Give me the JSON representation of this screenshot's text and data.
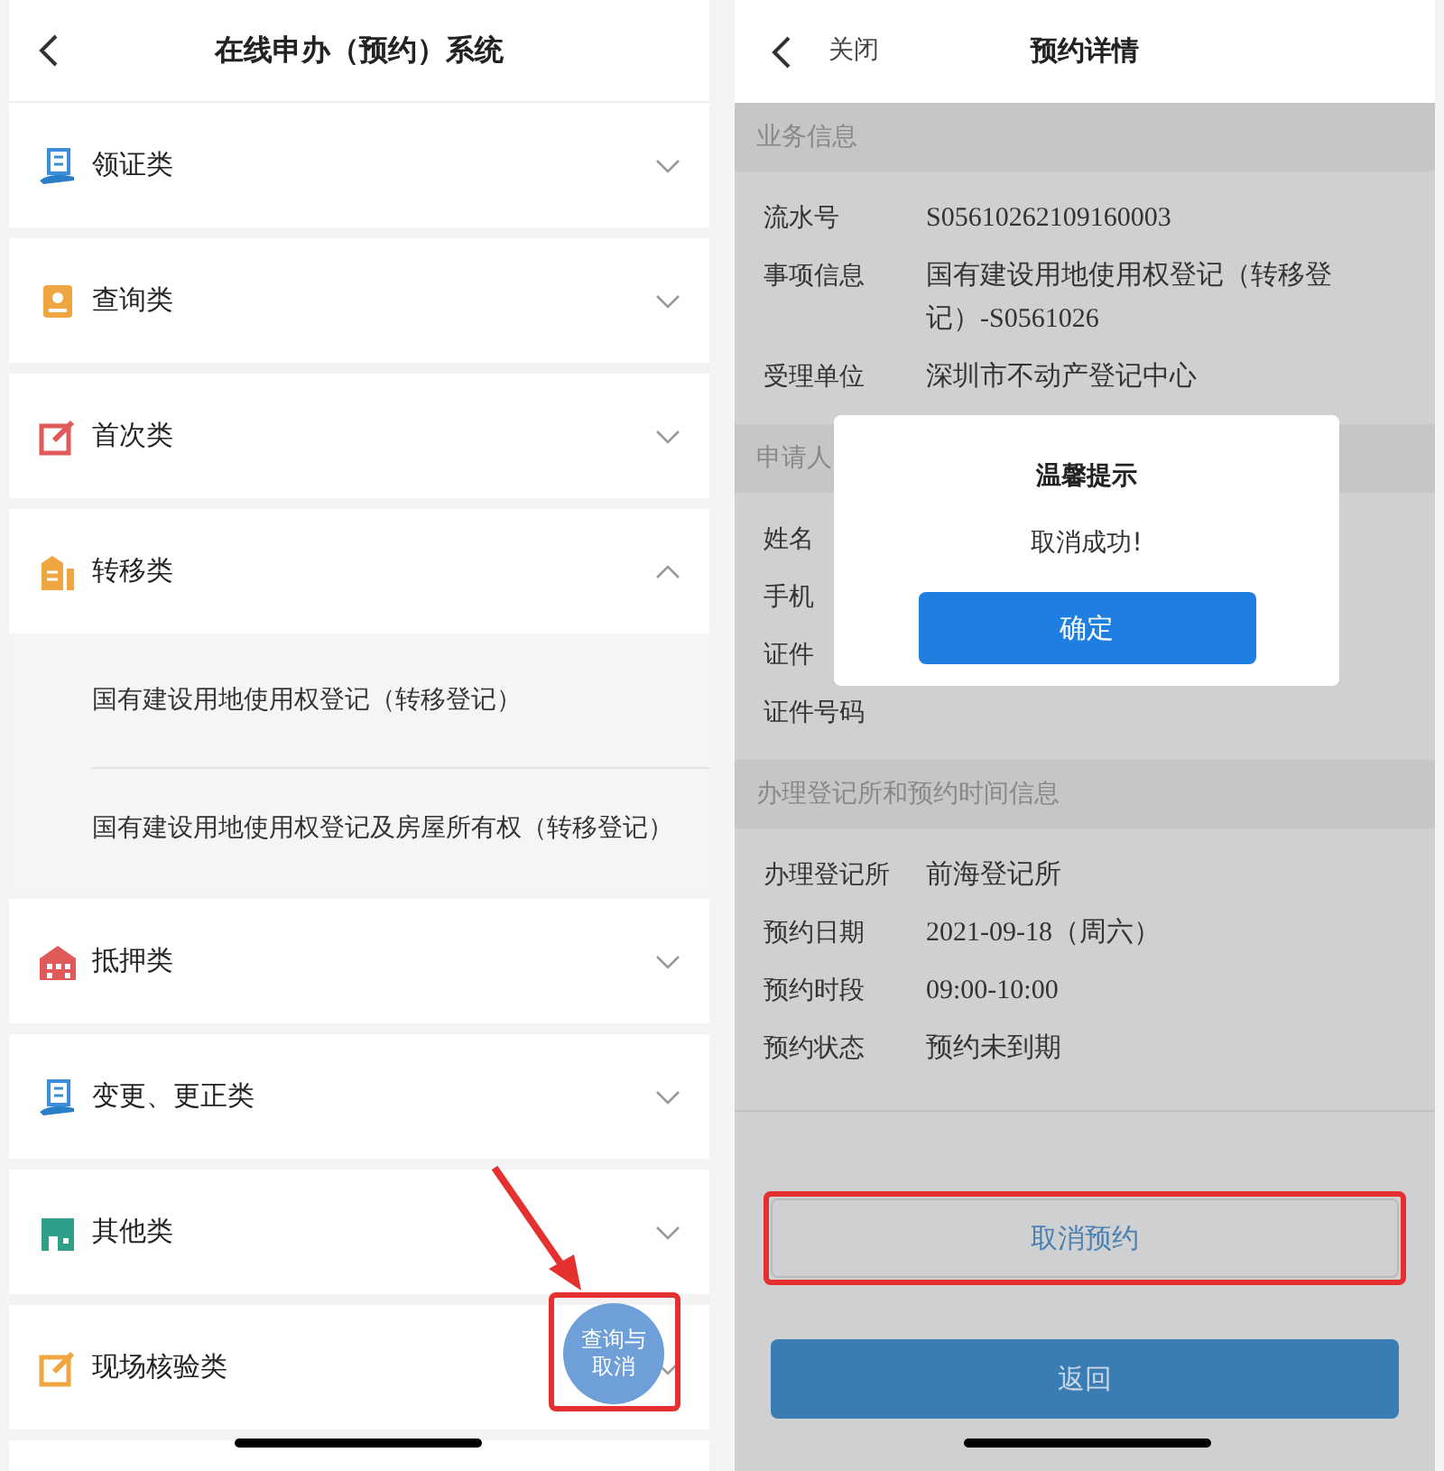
{
  "left_screen": {
    "header": {
      "title": "在线申办（预约）系统"
    },
    "categories": [
      {
        "label": "领证类",
        "expanded": false
      },
      {
        "label": "查询类",
        "expanded": false
      },
      {
        "label": "首次类",
        "expanded": false
      },
      {
        "label": "转移类",
        "expanded": true,
        "children": [
          "国有建设用地使用权登记（转移登记）",
          "国有建设用地使用权登记及房屋所有权（转移登记）"
        ]
      },
      {
        "label": "抵押类",
        "expanded": false
      },
      {
        "label": "变更、更正类",
        "expanded": false
      },
      {
        "label": "其他类",
        "expanded": false
      },
      {
        "label": "现场核验类",
        "expanded": false
      }
    ],
    "floating_button": "查询与取消"
  },
  "right_screen": {
    "header": {
      "close": "关闭",
      "title": "预约详情"
    },
    "sections": [
      {
        "title": "业务信息",
        "rows": [
          {
            "label": "流水号",
            "value": "S05610262109160003"
          },
          {
            "label": "事项信息",
            "value": "国有建设用地使用权登记（转移登记）-S0561026"
          },
          {
            "label": "受理单位",
            "value": "深圳市不动产登记中心"
          }
        ]
      },
      {
        "title": "申请人",
        "rows": [
          {
            "label": "姓名"
          },
          {
            "label": "手机"
          },
          {
            "label": "证件"
          },
          {
            "label": "证件号码"
          }
        ]
      },
      {
        "title": "办理登记所和预约时间信息",
        "rows": [
          {
            "label": "办理登记所",
            "value": "前海登记所"
          },
          {
            "label": "预约日期",
            "value": "2021-09-18（周六）"
          },
          {
            "label": "预约时段",
            "value": "09:00-10:00"
          },
          {
            "label": "预约状态",
            "value": "预约未到期"
          }
        ]
      }
    ],
    "buttons": [
      {
        "label": "取消预约",
        "kind": "outline"
      },
      {
        "label": "返回",
        "kind": "primary"
      }
    ],
    "dialog": {
      "title": "温馨提示",
      "message": "取消成功!",
      "button": "确定"
    }
  }
}
